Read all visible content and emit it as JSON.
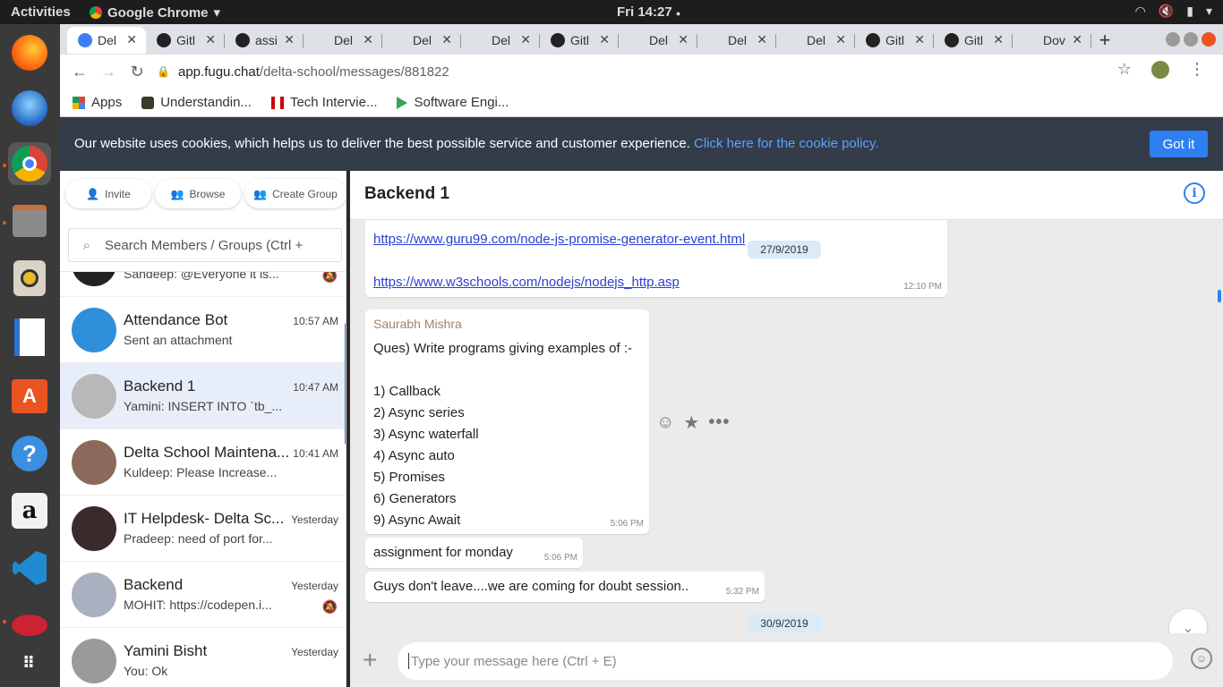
{
  "os": {
    "activities": "Activities",
    "app_name": "Google Chrome",
    "clock": "Fri 14:27",
    "clock_dot": "●"
  },
  "browser": {
    "tabs": [
      {
        "title": "Del",
        "icon": "fugu",
        "active": true
      },
      {
        "title": "Gitl",
        "icon": "github"
      },
      {
        "title": "assi",
        "icon": "github"
      },
      {
        "title": "Del",
        "icon": "none"
      },
      {
        "title": "Del",
        "icon": "none"
      },
      {
        "title": "Del",
        "icon": "none"
      },
      {
        "title": "Gitl",
        "icon": "github"
      },
      {
        "title": "Del",
        "icon": "none"
      },
      {
        "title": "Del",
        "icon": "none"
      },
      {
        "title": "Del",
        "icon": "none"
      },
      {
        "title": "Gitl",
        "icon": "github"
      },
      {
        "title": "Gitl",
        "icon": "github"
      },
      {
        "title": "Dov",
        "icon": "none"
      }
    ],
    "url_host": "app.fugu.chat",
    "url_path": "/delta-school/messages/881822",
    "bookmarks": [
      {
        "label": "Apps"
      },
      {
        "label": "Understandin..."
      },
      {
        "label": "Tech Intervie..."
      },
      {
        "label": "Software Engi..."
      }
    ]
  },
  "cookie_banner": {
    "text": "Our website uses cookies, which helps us to deliver the best possible service and customer experience. ",
    "link": "Click here for the cookie policy.",
    "button": "Got it"
  },
  "sidebar": {
    "actions": {
      "invite": "Invite",
      "browse": "Browse",
      "create_group": "Create Group"
    },
    "search_placeholder": "Search Members / Groups (Ctrl +",
    "partial_item": "Sandeep: @Everyone it is...",
    "conversations": [
      {
        "name": "Attendance Bot",
        "preview": "Sent an attachment",
        "time": "10:57 AM",
        "muted": false
      },
      {
        "name": "Backend 1",
        "preview": "Yamini: INSERT INTO `tb_...",
        "time": "10:47 AM",
        "muted": false,
        "active": true
      },
      {
        "name": "Delta School Maintena...",
        "preview": "Kuldeep: Please Increase...",
        "time": "10:41 AM",
        "muted": false
      },
      {
        "name": "IT Helpdesk- Delta Sc...",
        "preview": "Pradeep: need of port for...",
        "time": "Yesterday",
        "muted": false
      },
      {
        "name": "Backend",
        "preview": "MOHIT: https://codepen.i...",
        "time": "Yesterday",
        "muted": true
      },
      {
        "name": "Yamini Bisht",
        "preview": "You: Ok",
        "time": "Yesterday",
        "muted": false
      }
    ]
  },
  "chat": {
    "title": "Backend 1",
    "messages": {
      "link1": "https://www.guru99.com/node-js-promise-generator-event.html",
      "link2": "https://www.w3schools.com/nodejs/nodejs_http.asp",
      "link_time": "12:10 PM",
      "date1": "27/9/2019",
      "sender": "Saurabh Mishra",
      "ques_lines": [
        "Ques) Write programs giving examples of :-",
        "",
        "1) Callback",
        "2) Async series",
        "3) Async waterfall",
        "4) Async auto",
        "5) Promises",
        "6) Generators",
        "9) Async Await"
      ],
      "ques_time": "5:06 PM",
      "assignment": "assignment for monday",
      "assignment_time": "5:06 PM",
      "doubt": "Guys don't leave....we are coming for doubt session..",
      "doubt_time": "5:32 PM",
      "date2": "30/9/2019"
    },
    "composer_placeholder": "Type your message here (Ctrl + E)"
  }
}
